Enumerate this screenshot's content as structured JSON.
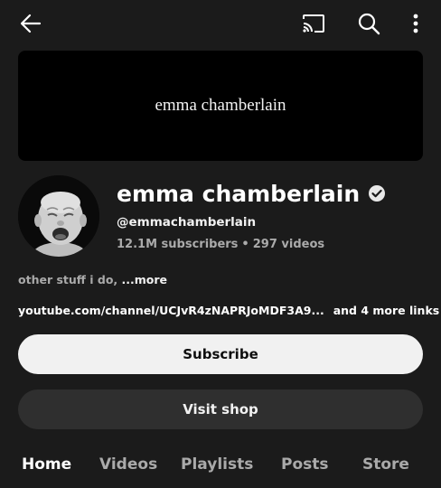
{
  "topbar": {
    "back_icon": "arrow-left-icon",
    "cast_icon": "cast-icon",
    "search_icon": "search-icon",
    "more_icon": "more-vertical-icon"
  },
  "banner": {
    "text": "emma chamberlain"
  },
  "channel": {
    "name": "emma chamberlain",
    "verified_icon": "verified-check-icon",
    "handle": "@emmachamberlain",
    "subscribers": "12.1M subscribers",
    "separator": "•",
    "videos": "297 videos",
    "description": "other stuff i do, ",
    "more_label": "...more",
    "link_url": "youtube.com/channel/UCJvR4zNAPRJoMDF3A9...",
    "more_links": "and 4 more links"
  },
  "actions": {
    "subscribe_label": "Subscribe",
    "shop_label": "Visit shop"
  },
  "tabs": [
    {
      "label": "Home",
      "active": true
    },
    {
      "label": "Videos",
      "active": false
    },
    {
      "label": "Playlists",
      "active": false
    },
    {
      "label": "Posts",
      "active": false
    },
    {
      "label": "Store",
      "active": false
    }
  ],
  "colors": {
    "background": "#1b1b1b",
    "banner": "#000000",
    "subscribe_bg": "#f1f1f1",
    "shop_bg": "#2f2f2f",
    "secondary_text": "#aaaaaa"
  }
}
